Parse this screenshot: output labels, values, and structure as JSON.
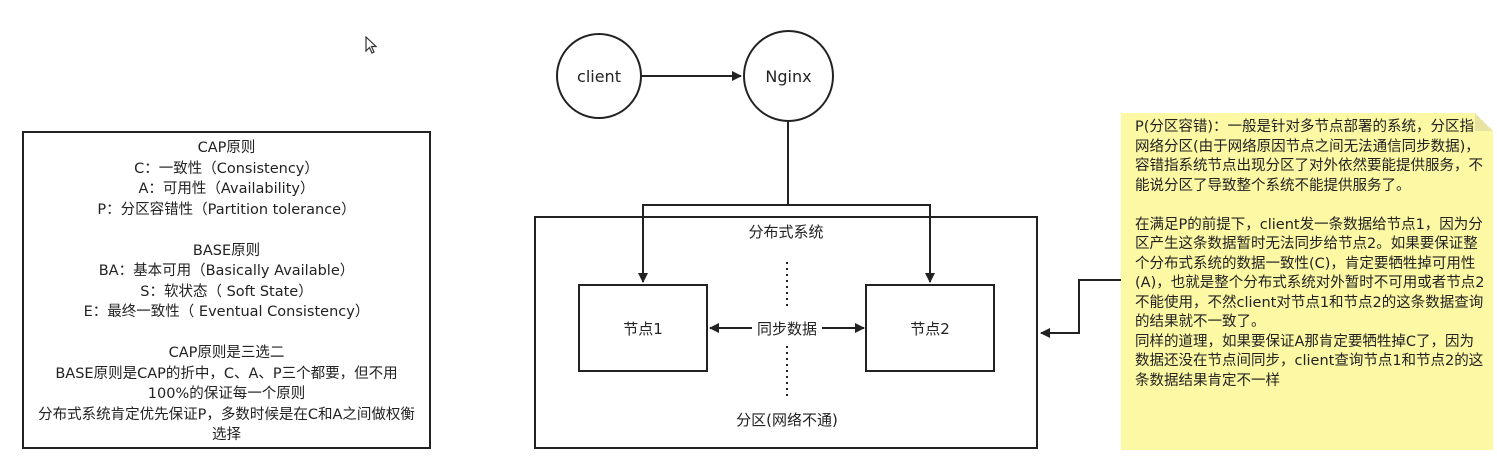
{
  "principles_box": {
    "cap_title": "CAP原则",
    "cap_c": "C：一致性（Consistency）",
    "cap_a": "A：可用性（Availability）",
    "cap_p": "P：分区容错性（Partition tolerance）",
    "base_title": "BASE原则",
    "base_ba": "BA：基本可用（Basically Available）",
    "base_s": "S：软状态（ Soft State）",
    "base_e": "E：最终一致性（ Eventual Consistency）",
    "summary_title": "CAP原则是三选二",
    "summary_1": "BASE原则是CAP的折中，C、A、P三个都要，但不用100%的保证每一个原则",
    "summary_2": "分布式系统肯定优先保证P，多数时候是在C和A之间做权衡选择"
  },
  "diagram": {
    "client": "client",
    "nginx": "Nginx",
    "system_label": "分布式系统",
    "node1": "节点1",
    "node2": "节点2",
    "sync_label": "同步数据",
    "partition_label": "分区(网络不通)"
  },
  "note": {
    "para1": "P(分区容错)：一般是针对多节点部署的系统，分区指网络分区(由于网络原因节点之间无法通信同步数据)，容错指系统节点出现分区了对外依然要能提供服务，不能说分区了导致整个系统不能提供服务了。",
    "para2": "在满足P的前提下，client发一条数据给节点1，因为分区产生这条数据暂时无法同步给节点2。如果要保证整个分布式系统的数据一致性(C)，肯定要牺牲掉可用性(A)，也就是整个分布式系统对外暂时不可用或者节点2不能使用，不然client对节点1和节点2的这条数据查询的结果就不一致了。",
    "para3": "同样的道理，如果要保证A那肯定要牺牲掉C了，因为数据还没在节点间同步，client查询节点1和节点2的这条数据结果肯定不一样",
    "background": "#fdf8a4"
  }
}
